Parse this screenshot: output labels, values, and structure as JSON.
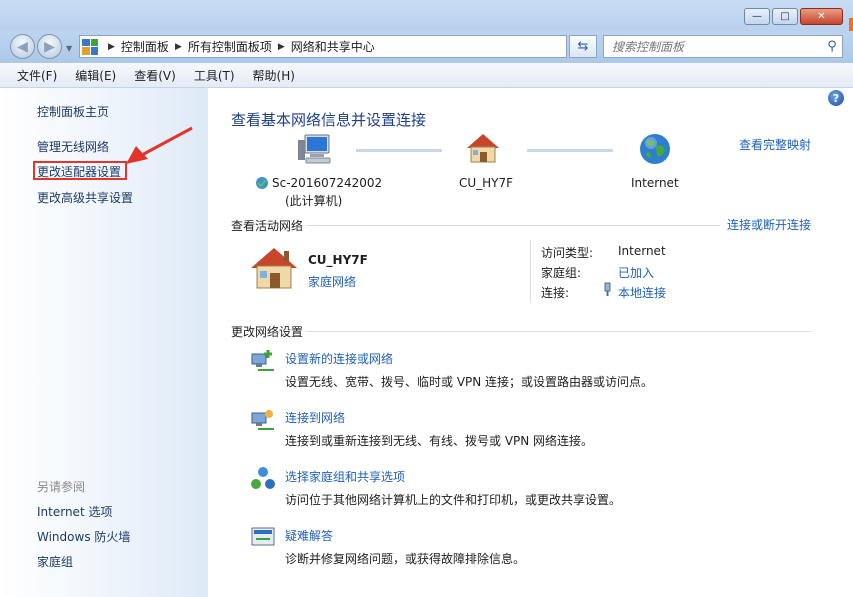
{
  "window": {
    "controls": {
      "minimize": "—",
      "maximize": "□",
      "close": "✕"
    }
  },
  "address": {
    "crumbs": [
      "控制面板",
      "所有控制面板项",
      "网络和共享中心"
    ],
    "search_placeholder": "搜索控制面板"
  },
  "menu": [
    "文件(F)",
    "编辑(E)",
    "查看(V)",
    "工具(T)",
    "帮助(H)"
  ],
  "sidebar": {
    "items": [
      "控制面板主页",
      "管理无线网络",
      "更改适配器设置",
      "更改高级共享设置"
    ],
    "see_also_title": "另请参阅",
    "see_also": [
      "Internet 选项",
      "Windows 防火墙",
      "家庭组"
    ]
  },
  "main": {
    "title": "查看基本网络信息并设置连接",
    "full_map_link": "查看完整映射",
    "map": {
      "computer_name": "Sc-201607242002",
      "computer_sub": "(此计算机)",
      "network_name": "CU_HY7F",
      "internet": "Internet"
    },
    "active_title": "查看活动网络",
    "connect_link": "连接或断开连接",
    "active": {
      "name": "CU_HY7F",
      "type_link": "家庭网络",
      "access_label": "访问类型:",
      "access_value": "Internet",
      "homegroup_label": "家庭组:",
      "homegroup_value": "已加入",
      "conn_label": "连接:",
      "conn_value": "本地连接"
    },
    "change_title": "更改网络设置",
    "tasks": [
      {
        "title": "设置新的连接或网络",
        "desc": "设置无线、宽带、拨号、临时或 VPN 连接；或设置路由器或访问点。"
      },
      {
        "title": "连接到网络",
        "desc": "连接到或重新连接到无线、有线、拨号或 VPN 网络连接。"
      },
      {
        "title": "选择家庭组和共享选项",
        "desc": "访问位于其他网络计算机上的文件和打印机，或更改共享设置。"
      },
      {
        "title": "疑难解答",
        "desc": "诊断并修复网络问题，或获得故障排除信息。"
      }
    ]
  },
  "colors": {
    "link": "#1f5fbf",
    "heading": "#1e3f8a",
    "annotation_red": "#e5332a"
  }
}
